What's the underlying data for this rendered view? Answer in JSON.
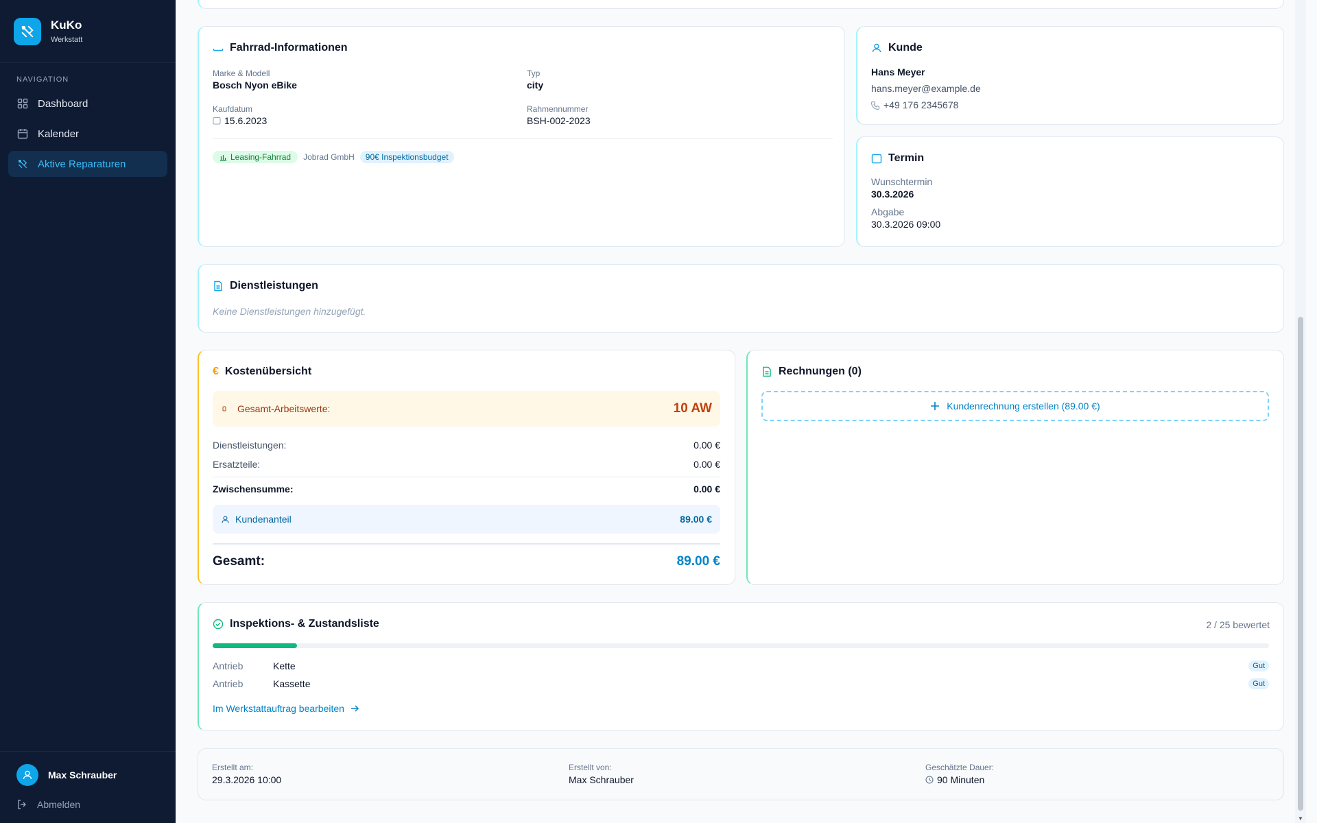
{
  "brand": {
    "title": "KuKo",
    "subtitle": "Werkstatt",
    "icon": "tools-icon"
  },
  "nav": {
    "section_label": "NAVIGATION",
    "items": [
      {
        "label": "Dashboard",
        "icon": "grid-icon",
        "active": false
      },
      {
        "label": "Kalender",
        "icon": "calendar-icon",
        "active": false
      },
      {
        "label": "Aktive Reparaturen",
        "icon": "tools-icon",
        "active": true
      }
    ]
  },
  "user": {
    "name": "Max Schrauber",
    "logout_label": "Abmelden"
  },
  "bike": {
    "title": "Fahrrad-Informationen",
    "brand_model_label": "Marke & Modell",
    "brand_model": "Bosch Nyon eBike",
    "type_label": "Typ",
    "type": "city",
    "purchase_label": "Kaufdatum",
    "purchase_date": "15.6.2023",
    "frame_label": "Rahmennummer",
    "frame_number": "BSH-002-2023",
    "leasing_badge": "Leasing-Fahrrad",
    "leasing_company": "Jobrad GmbH",
    "budget_badge": "90€ Inspektionsbudget"
  },
  "customer": {
    "title": "Kunde",
    "name": "Hans Meyer",
    "email": "hans.meyer@example.de",
    "phone": "+49 176 2345678"
  },
  "appointment": {
    "title": "Termin",
    "wish_label": "Wunschtermin",
    "wish_date": "30.3.2026",
    "dropoff_label": "Abgabe",
    "dropoff": "30.3.2026 09:00"
  },
  "services": {
    "title": "Dienstleistungen",
    "empty": "Keine Dienstleistungen hinzugefügt."
  },
  "costs": {
    "title": "Kostenübersicht",
    "currency_icon": "€",
    "aw_label": "Gesamt-Arbeitswerte:",
    "aw_value": "10 AW",
    "services_label": "Dienstleistungen:",
    "services_value": "0.00 €",
    "parts_label": "Ersatzteile:",
    "parts_value": "0.00 €",
    "subtotal_label": "Zwischensumme:",
    "subtotal_value": "0.00 €",
    "customer_share_label": "Kundenanteil",
    "customer_share_value": "89.00 €",
    "total_label": "Gesamt:",
    "total_value": "89.00 €"
  },
  "invoices": {
    "title": "Rechnungen (0)",
    "create_label": "Kundenrechnung erstellen (89.00 €)"
  },
  "inspection": {
    "title": "Inspektions- & Zustandsliste",
    "rated_text": "2 / 25 bewertet",
    "progress": 0.08,
    "items": [
      {
        "category": "Antrieb",
        "name": "Kette",
        "status": "Gut"
      },
      {
        "category": "Antrieb",
        "name": "Kassette",
        "status": "Gut"
      }
    ],
    "edit_link": "Im Werkstattauftrag bearbeiten"
  },
  "meta": {
    "created_label": "Erstellt am:",
    "created_value": "29.3.2026 10:00",
    "creator_label": "Erstellt von:",
    "creator_value": "Max Schrauber",
    "duration_label": "Geschätzte Dauer:",
    "duration_value": "90 Minuten"
  },
  "colors": {
    "sidebar": "#0f1b33",
    "accent": "#0ea5e9",
    "active_nav": "#38bdf8",
    "success": "#10b981",
    "warning": "#f59e0b"
  }
}
